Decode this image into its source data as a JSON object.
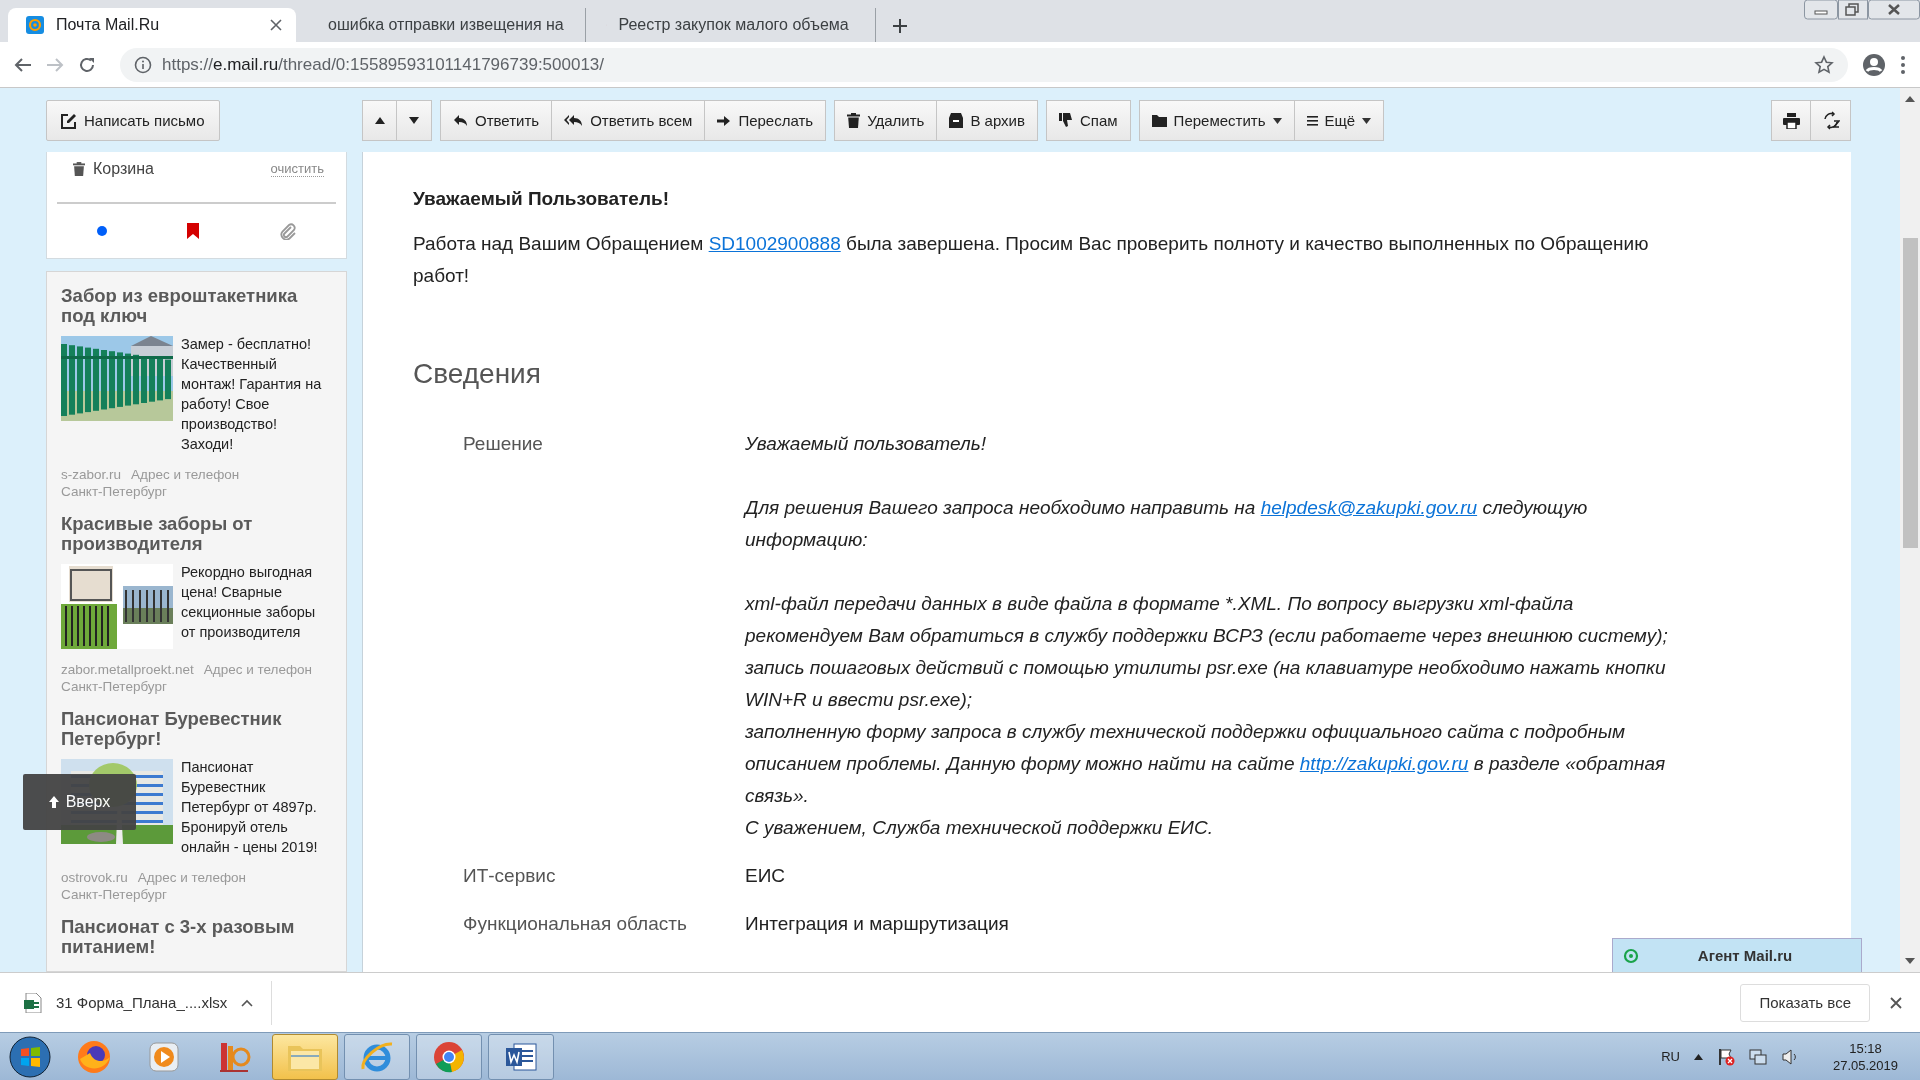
{
  "browser": {
    "tabs": [
      {
        "title": "Почта Mail.Ru",
        "selected": true
      },
      {
        "title": "ошибка отправки извещения на",
        "selected": false
      },
      {
        "title": "Реестр закупок малого объема",
        "selected": false
      }
    ],
    "url_scheme": "https://",
    "url_host": "e.mail.ru",
    "url_path": "/thread/0:15589593101141796739:500013/"
  },
  "toolbar": {
    "compose": "Написать письмо",
    "groups": [
      [
        {
          "kind": "up",
          "dropdown": false
        },
        {
          "kind": "down",
          "dropdown": false
        }
      ],
      [
        {
          "kind": "reply",
          "label": "Ответить",
          "dropdown": false
        },
        {
          "kind": "reply-all",
          "label": "Ответить всем",
          "dropdown": false
        },
        {
          "kind": "forward",
          "label": "Переслать",
          "dropdown": false
        }
      ],
      [
        {
          "kind": "delete",
          "label": "Удалить",
          "dropdown": false
        },
        {
          "kind": "archive",
          "label": "В архив",
          "dropdown": false
        }
      ],
      [
        {
          "kind": "spam",
          "label": "Спам",
          "dropdown": false
        }
      ],
      [
        {
          "kind": "move",
          "label": "Переместить",
          "dropdown": true
        },
        {
          "kind": "more",
          "label": "Ещё",
          "dropdown": true
        }
      ]
    ],
    "right_buttons": [
      {
        "kind": "print"
      },
      {
        "kind": "translit"
      }
    ]
  },
  "sidebar": {
    "trash": {
      "label": "Корзина",
      "action": "очистить"
    },
    "ads": [
      {
        "title": "Забор из евроштакетника под ключ",
        "text": "Замер - бесплатно! Качественный монтаж! Гарантия на работу! Свое производство! Заходи!",
        "site": "s-zabor.ru",
        "address": "Адрес и телефон",
        "city": "Санкт-Петербург"
      },
      {
        "title": "Красивые заборы от производителя",
        "text": "Рекордно выгодная цена! Сварные секционные заборы от производителя",
        "site": "zabor.metallproekt.net",
        "address": "Адрес и телефон",
        "city": "Санкт-Петербург"
      },
      {
        "title": "Пансионат Буревестник Петербург!",
        "text": "Пансионат Буревестник Петербург от 4897р. Бронируй отель онлайн - цены 2019!",
        "site": "ostrovok.ru",
        "address": "Адрес и телефон",
        "city": "Санкт-Петербург"
      },
      {
        "title": "Пансионат с 3-х разовым питанием!"
      }
    ],
    "back_to_top": "Вверх"
  },
  "message": {
    "greeting": "Уважаемый Пользователь!",
    "intro": [
      {
        "kind": "text",
        "text": "Работа над Вашим Обращением "
      },
      {
        "kind": "link",
        "text": "SD1002900888"
      },
      {
        "kind": "text",
        "text": " была завершена. Просим Вас проверить полноту и качество выполненных по Обращению работ!"
      }
    ],
    "section": "Сведения",
    "fields": [
      {
        "label": "Решение",
        "blocks": [
          [
            [
              {
                "kind": "text",
                "text": "Уважаемый пользователь!"
              }
            ]
          ],
          [
            [
              {
                "kind": "text",
                "text": "Для решения Вашего запроса необходимо направить на "
              },
              {
                "kind": "link",
                "text": "helpdesk@zakupki.gov.ru"
              },
              {
                "kind": "text",
                "text": " следующую информацию:"
              }
            ]
          ],
          [
            [
              {
                "kind": "text",
                "text": "xml-файл передачи данных в виде файла в формате *.XML. По вопросу выгрузки xml-файла рекомендуем Вам обратиться в службу поддержки ВСРЗ (если работаете через внешнюю систему);"
              }
            ],
            [
              {
                "kind": "text",
                "text": "запись пошаговых действий с помощью утилиты psr.exe (на клавиатуре необходимо нажать кнопки WIN+R и ввести psr.exe);"
              }
            ],
            [
              {
                "kind": "text",
                "text": "заполненную форму запроса в службу технической поддержки официального сайта с подробным описанием проблемы. Данную форму можно найти на сайте "
              },
              {
                "kind": "link",
                "text": "http://zakupki.gov.ru"
              },
              {
                "kind": "text",
                "text": " в разделе «обратная связь»."
              }
            ],
            [
              {
                "kind": "text",
                "text": "С уважением, Служба технической поддержки ЕИС."
              }
            ]
          ]
        ]
      },
      {
        "label": "ИТ-сервис",
        "value": "ЕИС"
      },
      {
        "label": "Функциональная область",
        "value": "Интеграция и маршрутизация"
      }
    ]
  },
  "agent": {
    "title": "Агент Mail.ru"
  },
  "download": {
    "file": "31 Форма_Плана_....xlsx",
    "show_all": "Показать все"
  },
  "taskbar": {
    "lang": "RU",
    "time": "15:18",
    "date": "27.05.2019"
  }
}
